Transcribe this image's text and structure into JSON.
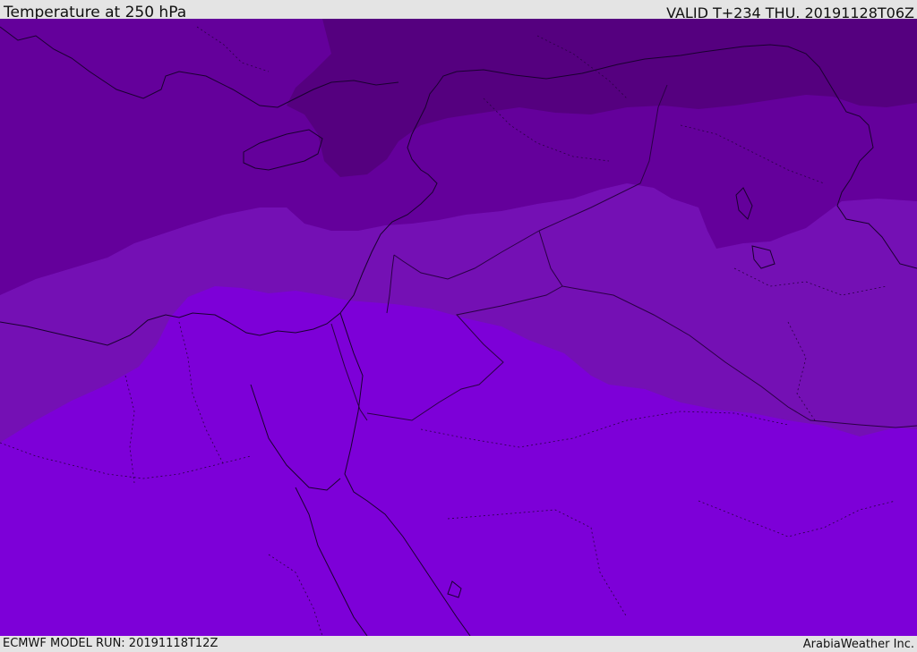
{
  "header": {
    "title": "Temperature at 250 hPa",
    "valid": "VALID T+234 THU. 20191128T06Z"
  },
  "footer": {
    "model_run": "ECMWF MODEL RUN: 20191118T12Z",
    "credit": "ArabiaWeather Inc."
  },
  "map": {
    "field": "temperature",
    "level": "250 hPa",
    "region": "Eastern Mediterranean / Middle East",
    "colors": {
      "coldest": "#55007f",
      "colder": "#64009b",
      "cold": "#7410b4",
      "mild": "#7d00d8",
      "warm": "#8a00ff",
      "coast_line": "#1a0030",
      "border_line": "#2a0045"
    }
  }
}
